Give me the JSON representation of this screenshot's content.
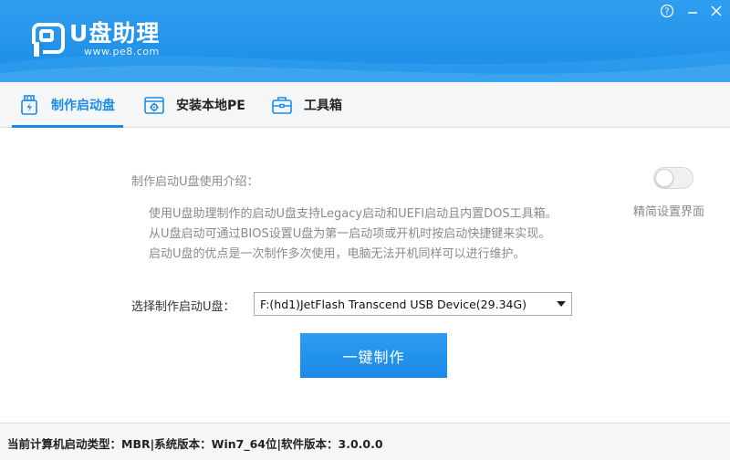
{
  "app": {
    "title": "U盘助理",
    "url": "www.pe8.com"
  },
  "window_controls": {
    "help_icon": "help-circle-icon",
    "minimize_icon": "minimize-icon",
    "close_icon": "close-icon"
  },
  "tabs": [
    {
      "label": "制作启动盘",
      "icon": "usb-lightning-icon",
      "active": true
    },
    {
      "label": "安装本地PE",
      "icon": "gear-window-icon",
      "active": false
    },
    {
      "label": "工具箱",
      "icon": "toolbox-icon",
      "active": false
    }
  ],
  "main": {
    "intro_title": "制作启动U盘使用介绍：",
    "intro_lines": [
      "使用U盘助理制作的启动U盘支持Legacy启动和UEFI启动且内置DOS工具箱。",
      "从U盘启动可通过BIOS设置U盘为第一启动项或开机时按启动快捷键来实现。",
      "启动U盘的优点是一次制作多次使用，电脑无法开机同样可以进行维护。"
    ],
    "toggle_label": "精简设置界面",
    "toggle_on": false,
    "select_label": "选择制作启动U盘：",
    "selected_device": "F:(hd1)JetFlash Transcend USB Device(29.34G)",
    "make_button": "一键制作"
  },
  "status": {
    "text": "当前计算机启动类型：MBR|系统版本：Win7_64位|软件版本：3.0.0.0"
  },
  "colors": {
    "brand_blue": "#1b8be6",
    "text_gray": "#8a8a8a"
  }
}
